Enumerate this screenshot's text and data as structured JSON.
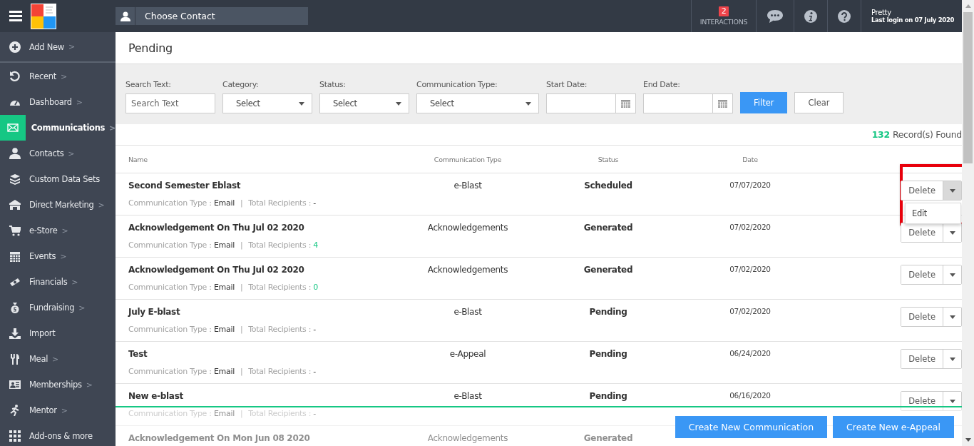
{
  "topbar": {
    "contact_placeholder": "Choose Contact",
    "interactions": {
      "count": "2",
      "label": "INTERACTIONS"
    },
    "user": {
      "name": "Pretty",
      "last_login": "Last login on 07 July 2020"
    }
  },
  "sidebar": {
    "items": [
      {
        "label": "Add New",
        "arrow": ">",
        "selected": false
      },
      {
        "label": "Recent",
        "arrow": ">",
        "selected": false
      },
      {
        "label": "Dashboard",
        "arrow": ">",
        "selected": false
      },
      {
        "label": "Communications",
        "arrow": ">",
        "selected": true
      },
      {
        "label": "Contacts",
        "arrow": ">",
        "selected": false
      },
      {
        "label": "Custom Data Sets",
        "selected": false
      },
      {
        "label": "Direct Marketing",
        "arrow": ">",
        "selected": false
      },
      {
        "label": "e-Store",
        "arrow": ">",
        "selected": false
      },
      {
        "label": "Events",
        "arrow": ">",
        "selected": false
      },
      {
        "label": "Financials",
        "arrow": ">",
        "selected": false
      },
      {
        "label": "Fundraising",
        "arrow": ">",
        "selected": false
      },
      {
        "label": "Import",
        "selected": false
      },
      {
        "label": "Meal",
        "arrow": ">",
        "selected": false
      },
      {
        "label": "Memberships",
        "arrow": ">",
        "selected": false
      },
      {
        "label": "Mentor",
        "arrow": ">",
        "selected": false
      },
      {
        "label": "Add-ons & more",
        "selected": false
      }
    ]
  },
  "page_title": "Pending",
  "filters": [
    {
      "kind": "text",
      "label": "Search Text:",
      "placeholder": "Search Text"
    },
    {
      "kind": "select",
      "label": "Category:",
      "value": "Select",
      "wide": false
    },
    {
      "kind": "select",
      "label": "Status:",
      "value": "Select",
      "wide": false
    },
    {
      "kind": "select",
      "label": "Communication Type:",
      "value": "Select",
      "wide": true
    },
    {
      "kind": "date",
      "label": "Start Date:"
    },
    {
      "kind": "date",
      "label": "End Date:"
    }
  ],
  "filter_buttons": [
    {
      "label": "Filter",
      "primary": true
    },
    {
      "label": "Clear",
      "primary": false
    }
  ],
  "record_count": {
    "count": "132",
    "label": "Record(s) Found"
  },
  "table": {
    "columns": [
      "Name",
      "Communication Type",
      "Status",
      "Date"
    ],
    "rows": [
      {
        "name": "Second Semester Eblast",
        "type_label": "Communication Type :",
        "type": "Email",
        "separator": "|",
        "recipients_label": "Total Recipients :",
        "recipients": "-",
        "communication_type": "e-Blast",
        "status": "Scheduled",
        "date": "07/07/2020",
        "action": "Delete",
        "menu_open": true,
        "menu": [
          "Edit"
        ],
        "highlighted": true
      },
      {
        "name": "Acknowledgement On Thu Jul 02 2020",
        "type_label": "Communication Type :",
        "type": "Email",
        "separator": "|",
        "recipients_label": "Total Recipients :",
        "recipients": "4",
        "communication_type": "Acknowledgements",
        "status": "Generated",
        "date": "07/02/2020",
        "action": "Delete",
        "menu_open": false,
        "highlighted": false
      },
      {
        "name": "Acknowledgement On Thu Jul 02 2020",
        "type_label": "Communication Type :",
        "type": "Email",
        "separator": "|",
        "recipients_label": "Total Recipients :",
        "recipients": "0",
        "communication_type": "Acknowledgements",
        "status": "Generated",
        "date": "07/02/2020",
        "action": "Delete",
        "menu_open": false,
        "highlighted": false
      },
      {
        "name": "July E-blast",
        "type_label": "Communication Type :",
        "type": "Email",
        "separator": "|",
        "recipients_label": "Total Recipients :",
        "recipients": "-",
        "communication_type": "e-Blast",
        "status": "Pending",
        "date": "07/02/2020",
        "action": "Delete",
        "menu_open": false,
        "highlighted": false
      },
      {
        "name": "Test",
        "type_label": "Communication Type :",
        "type": "Email",
        "separator": "|",
        "recipients_label": "Total Recipients :",
        "recipients": "-",
        "communication_type": "e-Appeal",
        "status": "Pending",
        "date": "06/24/2020",
        "action": "Delete",
        "menu_open": false,
        "highlighted": false
      },
      {
        "name": "New e-blast",
        "type_label": "Communication Type :",
        "type": "Email",
        "separator": "|",
        "recipients_label": "Total Recipients :",
        "recipients": "-",
        "communication_type": "e-Blast",
        "status": "Pending",
        "date": "06/16/2020",
        "action": "Delete",
        "menu_open": false,
        "highlighted": false
      },
      {
        "name": "Acknowledgement On Mon Jun 08 2020",
        "communication_type": "Acknowledgements",
        "status": "Generated"
      }
    ]
  },
  "footer_buttons": [
    "Create New Communication",
    "Create New e-Appeal"
  ]
}
